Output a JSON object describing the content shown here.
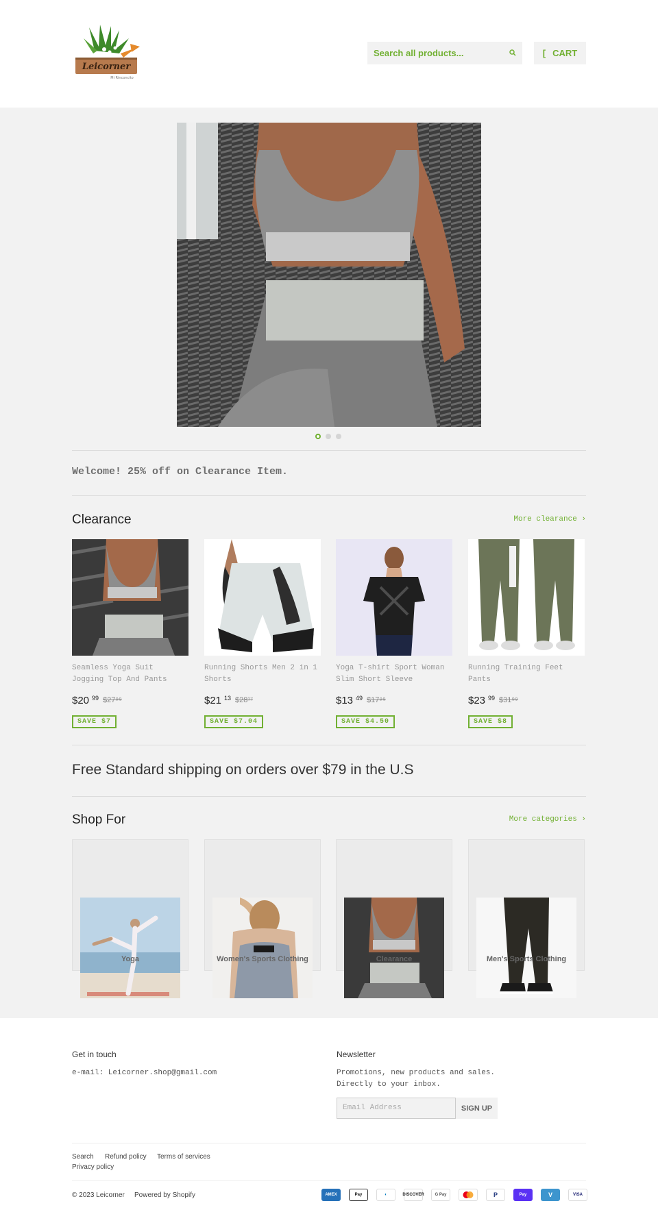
{
  "header": {
    "logo_text": "Leicorner",
    "logo_sub": "Mi Rinconcito",
    "search_placeholder": "Search all products...",
    "cart_label": "CART",
    "cart_glyph": "["
  },
  "hero": {
    "slide_count": 3,
    "active_slide": 1
  },
  "welcome": "Welcome! 25% off on Clearance Item.",
  "clearance": {
    "title": "Clearance",
    "more_label": "More clearance ›",
    "products": [
      {
        "title": "Seamless Yoga Suit Jogging Top And Pants",
        "price_main": "$20",
        "price_cents": "99",
        "price_was": "$27⁹⁹",
        "save": "SAVE $7"
      },
      {
        "title": "Running Shorts Men 2 in 1 Shorts",
        "price_main": "$21",
        "price_cents": "13",
        "price_was": "$28¹⁷",
        "save": "SAVE $7.04"
      },
      {
        "title": "Yoga T-shirt Sport Woman Slim Short Sleeve",
        "price_main": "$13",
        "price_cents": "49",
        "price_was": "$17⁹⁹",
        "save": "SAVE $4.50"
      },
      {
        "title": "Running Training Feet Pants",
        "price_main": "$23",
        "price_cents": "99",
        "price_was": "$31⁹⁹",
        "save": "SAVE $8"
      }
    ]
  },
  "shipping": "Free Standard shipping on orders over $79 in the U.S",
  "shop_for": {
    "title": "Shop For",
    "more_label": "More categories ›",
    "categories": [
      {
        "label": "Yoga"
      },
      {
        "label": "Women's Sports Clothing"
      },
      {
        "label": "Clearance"
      },
      {
        "label": "Men's Sports Clothing"
      }
    ]
  },
  "footer": {
    "contact_heading": "Get in touch",
    "contact_text": "e-mail: Leicorner.shop@gmail.com",
    "newsletter_heading": "Newsletter",
    "newsletter_text_1": "Promotions, new products and sales.",
    "newsletter_text_2": "Directly to your inbox.",
    "email_placeholder": "Email Address",
    "signup_label": "SIGN UP",
    "links": [
      "Search",
      "Refund policy",
      "Terms of services",
      "Privacy policy"
    ],
    "copyright": "© 2023 Leicorner",
    "powered": "Powered by Shopify",
    "payments": [
      "AMEX",
      "Apple Pay",
      "Diners",
      "DISCOVER",
      "G Pay",
      "Mastercard",
      "PayPal",
      "Shop Pay",
      "Venmo",
      "VISA"
    ]
  },
  "colors": {
    "accent": "#71b032",
    "background": "#f2f2f2"
  }
}
